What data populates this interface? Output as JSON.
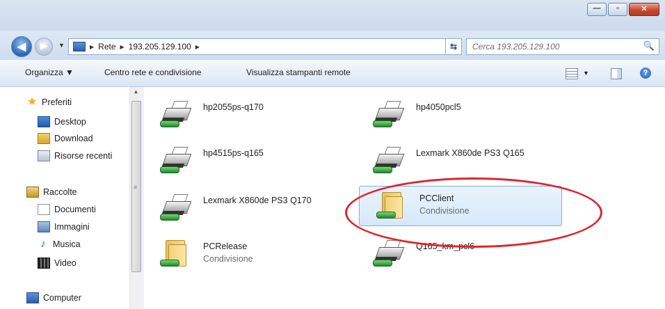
{
  "window": {
    "minimize_glyph": "—",
    "maximize_glyph": "▫",
    "close_glyph": "✕"
  },
  "address": {
    "back_glyph": "◀",
    "forward_glyph": "▶",
    "history_glyph": "▼",
    "crumbs": [
      "Rete",
      "193.205.129.100"
    ],
    "separator": "▶",
    "dropdown_glyph": "▼",
    "refresh_glyph": "⇆"
  },
  "search": {
    "placeholder": "Cerca 193.205.129.100",
    "icon": "🔍"
  },
  "toolbar": {
    "organize_label": "Organizza ▼",
    "network_center_label": "Centro rete e condivisione",
    "remote_printers_label": "Visualizza stampanti remote",
    "view_dropdown_glyph": "▼",
    "help_glyph": "?"
  },
  "nav": {
    "favorites_label": "Preferiti",
    "desktop_label": "Desktop",
    "download_label": "Download",
    "recent_label": "Risorse recenti",
    "libraries_label": "Raccolte",
    "documents_label": "Documenti",
    "images_label": "Immagini",
    "music_label": "Musica",
    "video_label": "Video",
    "computer_label": "Computer",
    "star_glyph": "★",
    "music_glyph": "♪"
  },
  "scroll": {
    "up_glyph": "▲",
    "grip_glyph": "≡"
  },
  "items": [
    {
      "name": "hp2055ps-q170",
      "sub": "",
      "type": "printer"
    },
    {
      "name": "hp4050pcl5",
      "sub": "",
      "type": "printer"
    },
    {
      "name": "hp4515ps-q165",
      "sub": "",
      "type": "printer"
    },
    {
      "name": "Lexmark X860de PS3 Q165",
      "sub": "",
      "type": "printer"
    },
    {
      "name": "Lexmark X860de PS3 Q170",
      "sub": "",
      "type": "printer"
    },
    {
      "name": "PCClient",
      "sub": "Condivisione",
      "type": "share",
      "selected": true
    },
    {
      "name": "PCRelease",
      "sub": "Condivisione",
      "type": "share"
    },
    {
      "name": "Q165_km_pcl6",
      "sub": "",
      "type": "printer"
    }
  ],
  "annotation_color": "#e0242d"
}
